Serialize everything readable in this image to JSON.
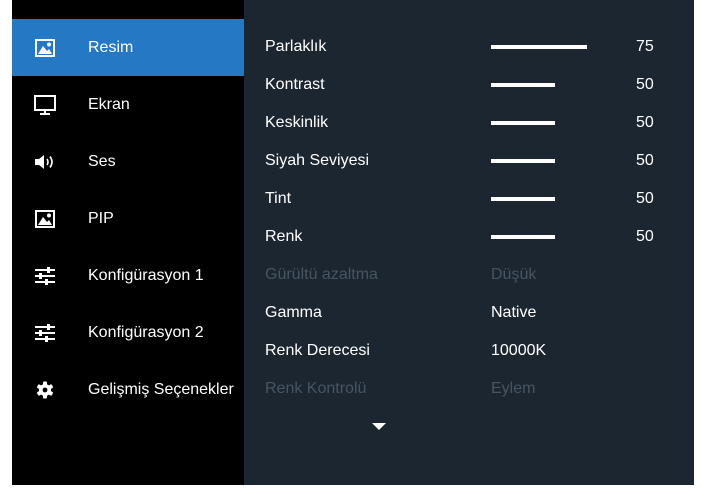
{
  "sidebar": {
    "items": [
      {
        "label": "Resim",
        "icon": "image-icon",
        "active": true
      },
      {
        "label": "Ekran",
        "icon": "monitor-icon"
      },
      {
        "label": "Ses",
        "icon": "speaker-icon"
      },
      {
        "label": "PIP",
        "icon": "pip-icon"
      },
      {
        "label": "Konfigürasyon 1",
        "icon": "sliders-icon"
      },
      {
        "label": "Konfigürasyon 2",
        "icon": "sliders-icon"
      },
      {
        "label": "Gelişmiş Seçenekler",
        "icon": "gear-icon"
      }
    ]
  },
  "settings": [
    {
      "label": "Parlaklık",
      "value": "75",
      "level": 75
    },
    {
      "label": "Kontrast",
      "value": "50",
      "level": 50
    },
    {
      "label": "Keskinlik",
      "value": "50",
      "level": 50
    },
    {
      "label": "Siyah Seviyesi",
      "value": "50",
      "level": 50
    },
    {
      "label": "Tint",
      "value": "50",
      "level": 50
    },
    {
      "label": "Renk",
      "value": "50",
      "level": 50
    },
    {
      "label": "Gürültü azaltma",
      "value": "Düşük",
      "disabled": true
    },
    {
      "label": "Gamma",
      "value": "Native"
    },
    {
      "label": "Renk Derecesi",
      "value": "10000K"
    },
    {
      "label": "Renk Kontrolü",
      "value": "Eylem",
      "disabled": true
    }
  ],
  "scroll_icon": "caret-down-icon",
  "colors": {
    "sidebar_bg": "#000000",
    "content_bg": "#1c2631",
    "active_bg": "#2478c4",
    "text": "#ffffff",
    "disabled_text": "#485460"
  }
}
